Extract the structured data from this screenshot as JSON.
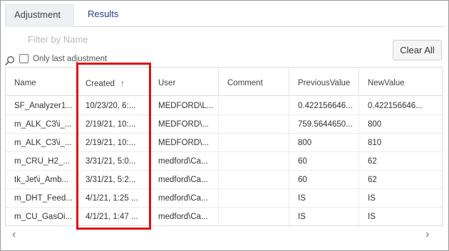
{
  "tabs": [
    {
      "label": "Adjustment",
      "active": true
    },
    {
      "label": "Results",
      "active": false
    }
  ],
  "filter": {
    "placeholder": "Filter by Name",
    "only_last_label": "Only last adjustment",
    "only_last_checked": false,
    "clear_label": "Clear All"
  },
  "table": {
    "columns": [
      "Name",
      "Created",
      "User",
      "Comment",
      "PreviousValue",
      "NewValue"
    ],
    "sort_indicator": "↑",
    "rows": [
      [
        "SF_Analyzer1...",
        "10/23/20, 6:...",
        "MEDFORD\\L...",
        "",
        "0.422156646...",
        "0.422156646..."
      ],
      [
        "m_ALK_C3\\i_...",
        "2/19/21, 10:...",
        "MEDFORD\\...",
        "",
        "759.5644650...",
        "800"
      ],
      [
        "m_ALK_C3\\i_...",
        "2/19/21, 10:...",
        "MEDFORD\\...",
        "",
        "800",
        "810"
      ],
      [
        "m_CRU_H2_...",
        "3/31/21, 5:0...",
        "medford\\Ca...",
        "",
        "60",
        "62"
      ],
      [
        "tk_Jet\\i_Amb...",
        "3/31/21, 5:2...",
        "medford\\Ca...",
        "",
        "60",
        "62"
      ],
      [
        "m_DHT_Feed...",
        "4/1/21, 1:25 ...",
        "medford\\Ca...",
        "",
        "IS",
        "IS"
      ],
      [
        "m_CU_GasOi...",
        "4/1/21, 1:47 ...",
        "medford\\Ca...",
        "",
        "IS",
        "IS"
      ]
    ]
  },
  "scroll": {
    "left": "‹",
    "right": "›"
  },
  "colors": {
    "accent_tab": "#1f3c88",
    "highlight": "#e01010"
  }
}
